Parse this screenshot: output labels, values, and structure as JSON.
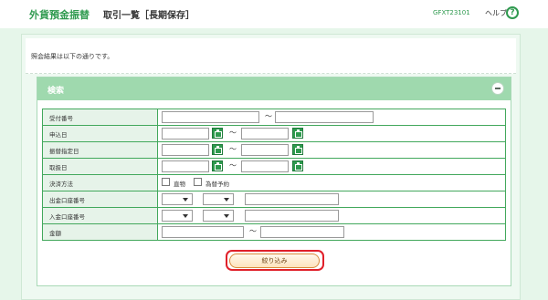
{
  "header": {
    "app_title": "外貨預金振替",
    "screen_title": "取引一覧［長期保存］",
    "screen_code": "GFXT23101",
    "help_label": "ヘルプ",
    "help_icon": "question-icon"
  },
  "intro": {
    "text": "照会結果は以下の通りです。"
  },
  "search": {
    "title": "検索",
    "collapse_icon": "minus-circle-icon",
    "rows": [
      {
        "label": "受付番号",
        "kind": "text-range",
        "from": "",
        "to": ""
      },
      {
        "label": "申込日",
        "kind": "date-range",
        "from": "",
        "to": ""
      },
      {
        "label": "振替指定日",
        "kind": "date-range",
        "from": "",
        "to": ""
      },
      {
        "label": "取扱日",
        "kind": "date-range",
        "from": "",
        "to": ""
      },
      {
        "label": "決済方法",
        "kind": "checkboxes",
        "options": [
          "直物",
          "為替予約"
        ]
      },
      {
        "label": "出金口座番号",
        "kind": "account"
      },
      {
        "label": "入金口座番号",
        "kind": "account"
      },
      {
        "label": "金額",
        "kind": "text-range",
        "from": "",
        "to": ""
      }
    ],
    "tilde": "～",
    "filter_button": "絞り込み"
  },
  "colors": {
    "brand_green": "#2f9a4f",
    "header_green": "#9fd9ae",
    "highlight_red": "#e0202a"
  }
}
